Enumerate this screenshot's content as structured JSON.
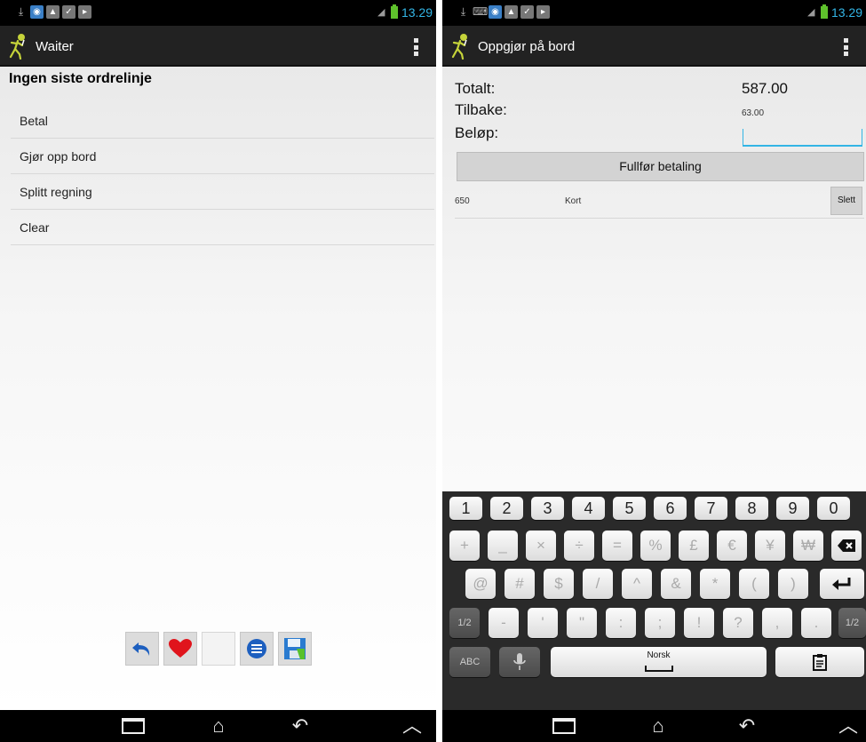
{
  "status_bar": {
    "time": "13.29"
  },
  "left": {
    "title": "Waiter",
    "heading": "Ingen siste ordrelinje",
    "menu_items": [
      "Betal",
      "Gjør opp bord",
      "Splitt regning",
      "Clear"
    ],
    "toolbar_icons": [
      "undo-icon",
      "heart-icon",
      "blank",
      "list-icon",
      "save-icon"
    ]
  },
  "right": {
    "title": "Oppgjør på bord",
    "total_label": "Totalt:",
    "total_value": "587.00",
    "change_label": "Tilbake:",
    "change_value": "63.00",
    "amount_label": "Beløp:",
    "amount_value": "",
    "complete_button": "Fullfør betaling",
    "payments": [
      {
        "amount": "650",
        "type": "Kort",
        "delete_label": "Slett"
      }
    ]
  },
  "keyboard": {
    "row1": [
      "1",
      "2",
      "3",
      "4",
      "5",
      "6",
      "7",
      "8",
      "9",
      "0"
    ],
    "row2": [
      "+",
      "_",
      "×",
      "÷",
      "=",
      "%",
      "£",
      "€",
      "¥",
      "₩"
    ],
    "row3": [
      "@",
      "#",
      "$",
      "/",
      "^",
      "&",
      "*",
      "(",
      ")"
    ],
    "row4_left": "1/2",
    "row4": [
      "-",
      "'",
      "\"",
      ":",
      ";",
      "!",
      "?",
      ",",
      "."
    ],
    "row4_right": "1/2",
    "abc_label": "ABC",
    "space_label": "Norsk"
  },
  "colors": {
    "accent": "#33b5e5",
    "battery": "#5fc22c",
    "actionbar": "#222222"
  }
}
